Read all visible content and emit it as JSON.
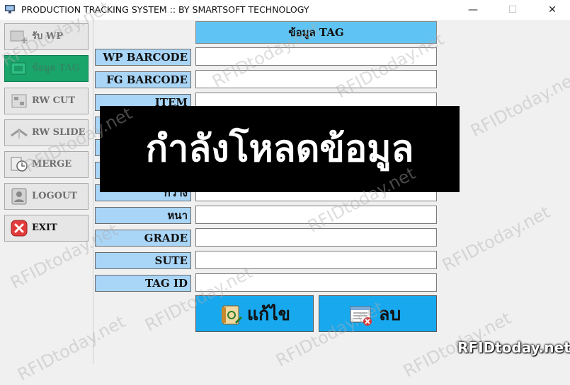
{
  "window": {
    "title": "PRODUCTION TRACKING SYSTEM :: BY SMARTSOFT TECHNOLOGY",
    "minimize": "—",
    "maximize": "☐",
    "close": "✕"
  },
  "sidebar": {
    "items": [
      {
        "label": "รับ WP",
        "icon": "receive-wp-icon"
      },
      {
        "label": "ข้อมูล TAG",
        "icon": "tag-data-icon"
      },
      {
        "label": "RW CUT",
        "icon": "rw-cut-icon"
      },
      {
        "label": "RW SLIDE",
        "icon": "rw-slide-icon"
      },
      {
        "label": "MERGE",
        "icon": "merge-icon"
      },
      {
        "label": "LOGOUT",
        "icon": "logout-icon"
      },
      {
        "label": "EXIT",
        "icon": "exit-icon"
      }
    ]
  },
  "form": {
    "header": "ข้อมูล TAG",
    "fields": [
      {
        "label": "WP BARCODE",
        "value": ""
      },
      {
        "label": "FG BARCODE",
        "value": ""
      },
      {
        "label": "ITEM",
        "value": ""
      },
      {
        "label": "",
        "value": ""
      },
      {
        "label": "",
        "value": ""
      },
      {
        "label": "",
        "value": ""
      },
      {
        "label": "กว้าง",
        "value": ""
      },
      {
        "label": "หนา",
        "value": ""
      },
      {
        "label": "GRADE",
        "value": ""
      },
      {
        "label": "SUTE",
        "value": ""
      },
      {
        "label": "TAG ID",
        "value": ""
      }
    ],
    "edit_label": "แก้ไข",
    "delete_label": "ลบ"
  },
  "overlay": {
    "text": "กำลังโหลดข้อมูล"
  },
  "watermark": {
    "text": "RFIDtoday.net"
  },
  "colors": {
    "header": "#5fc4f3",
    "label_bg": "#a9d5f7",
    "action_button": "#18a8ee",
    "active_sidebar": "#1aa56b"
  }
}
